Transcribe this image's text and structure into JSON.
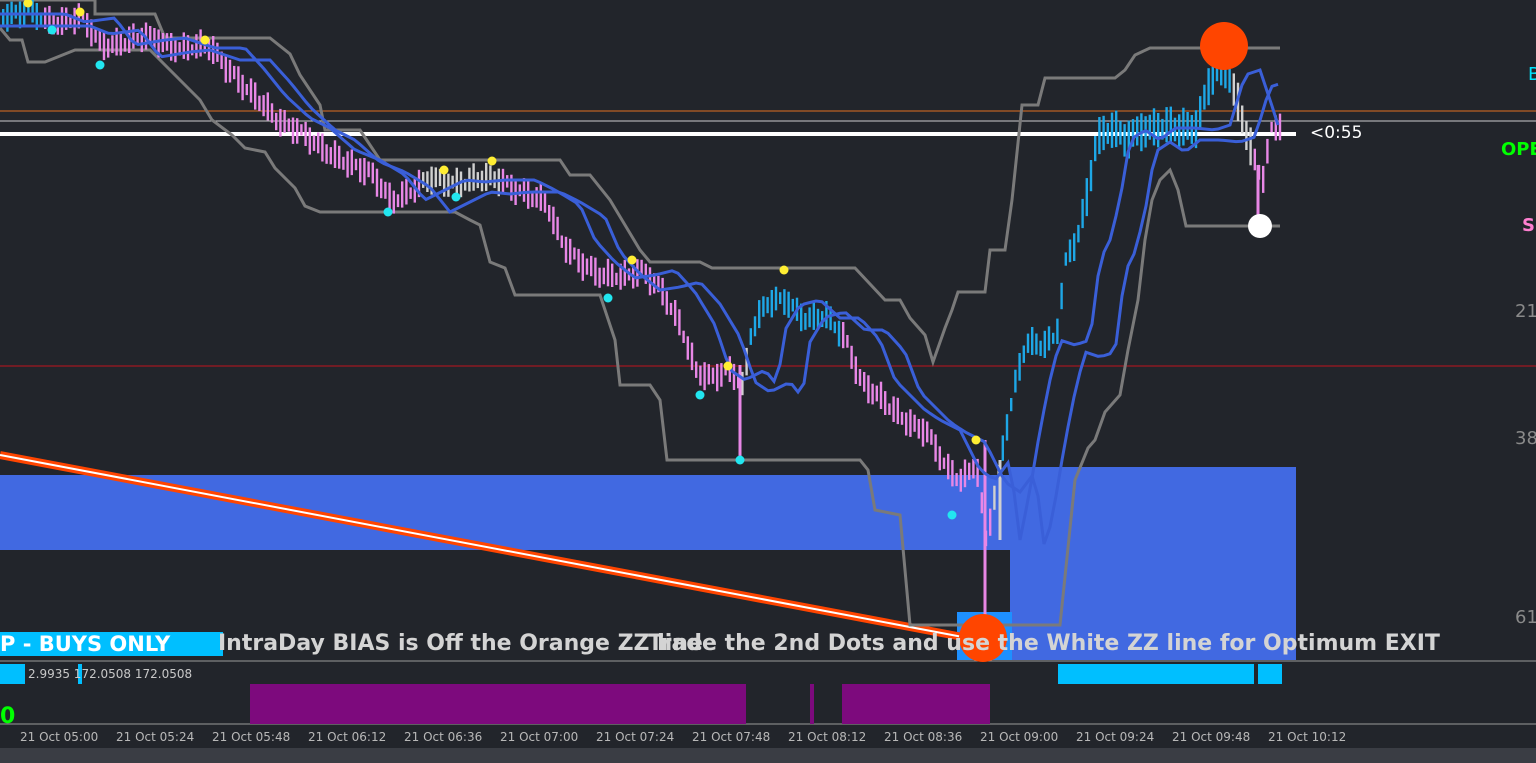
{
  "chart": {
    "timer": "<0:55",
    "right_labels": [
      "B",
      "OPE",
      "S",
      "21",
      "38",
      "61"
    ],
    "right_label_colors": [
      "#00e5ff",
      "#00ff00",
      "#ff7fd0",
      "#8a8a8a",
      "#8a8a8a",
      "#8a8a8a"
    ],
    "banner_left": "P - BUYS ONLY",
    "banner_middle": "IntraDay BIAS is Off the Orange ZZ line",
    "banner_right": "Trade the 2nd Dots and use the White ZZ line for Optimum EXIT",
    "indicator_values": "2.9935 172.0508 172.0508",
    "indicator_zero": "0",
    "time_labels": [
      "21 Oct 05:00",
      "21 Oct 05:24",
      "21 Oct 05:48",
      "21 Oct 06:12",
      "21 Oct 06:36",
      "21 Oct 07:00",
      "21 Oct 07:24",
      "21 Oct 07:48",
      "21 Oct 08:12",
      "21 Oct 08:36",
      "21 Oct 09:00",
      "21 Oct 09:24",
      "21 Oct 09:48",
      "21 Oct 10:12"
    ],
    "colors": {
      "background": "#22252b",
      "bull_bar": "#1ea7e6",
      "bear_bar": "#e887e6",
      "neutral_bar": "#d0d0d0",
      "moving_average": "#3a5fd8",
      "channel": "#7a7a7a",
      "zone": "#4169e1",
      "orange_zz": "#ff4500",
      "histogram_purple": "#7d0a7d",
      "histogram_cyan": "#00bfff"
    }
  }
}
